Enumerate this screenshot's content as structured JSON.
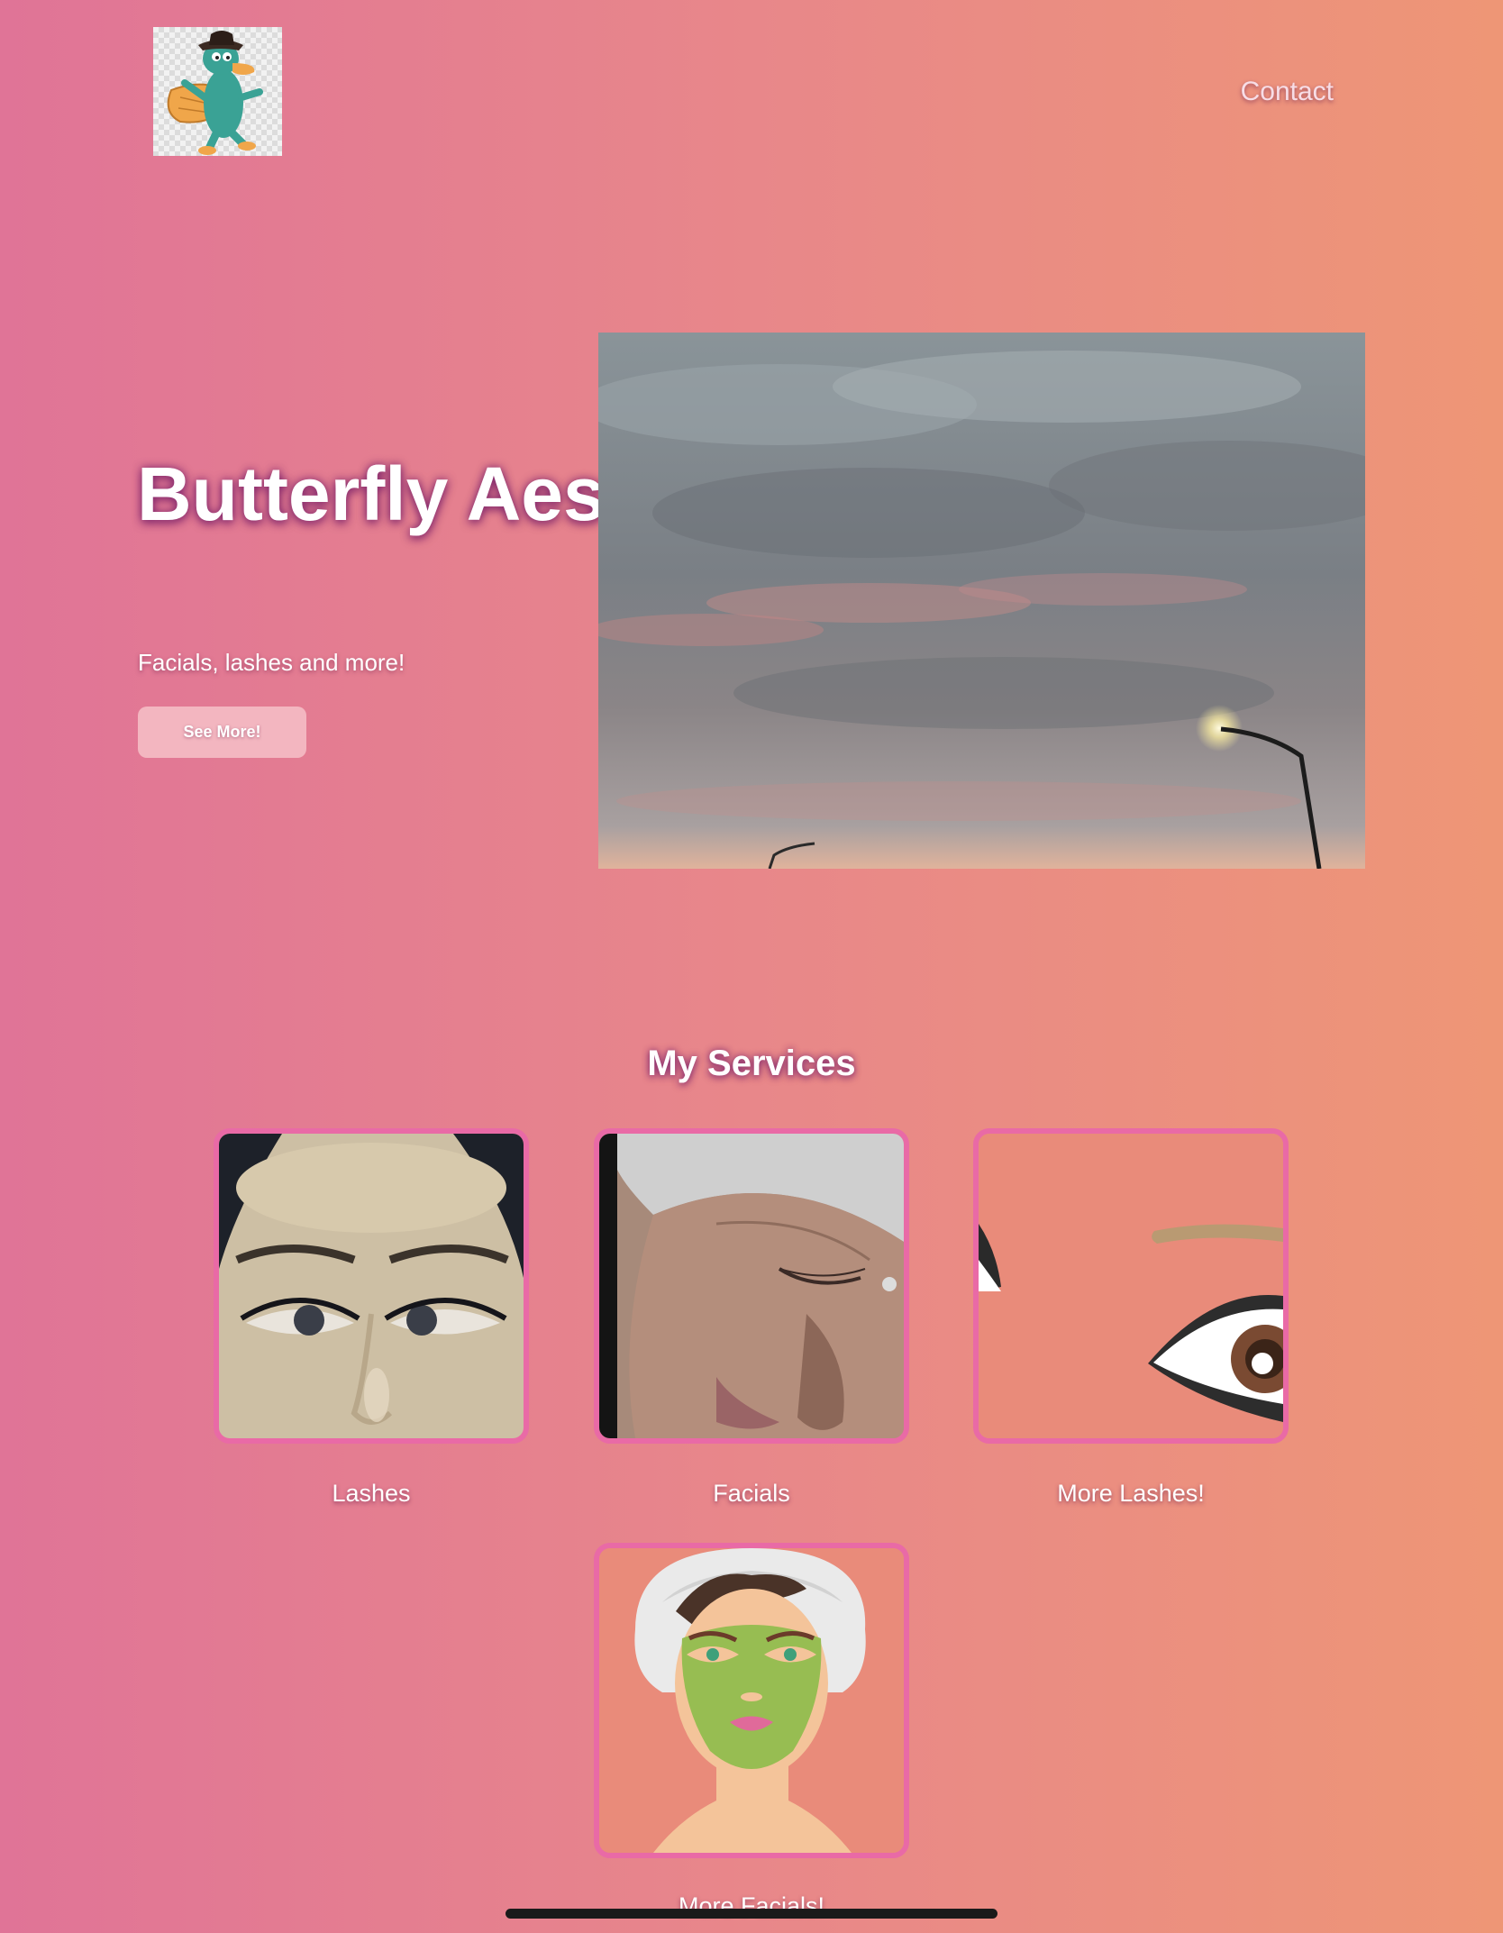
{
  "header": {
    "logo_icon": "platypus-character-icon",
    "contact_label": "Contact"
  },
  "hero": {
    "title": "Butterfly Aesthetics",
    "subtitle": "Facials, lashes and more!",
    "cta_label": "See More!",
    "photo_icon": "cloudy-sunset-sky-photo"
  },
  "services": {
    "heading": "My Services",
    "items": [
      {
        "label": "Lashes",
        "image": "lash-extensions-photo"
      },
      {
        "label": "Facials",
        "image": "facial-treatment-photo"
      },
      {
        "label": "More Lashes!",
        "image": "eye-illustration"
      },
      {
        "label": "More Facials!",
        "image": "face-mask-illustration"
      }
    ]
  },
  "colors": {
    "gradient_start": "#e07497",
    "gradient_end": "#ee9676",
    "card_border": "#e96aa6",
    "button_bg": "#f3b6c0"
  }
}
